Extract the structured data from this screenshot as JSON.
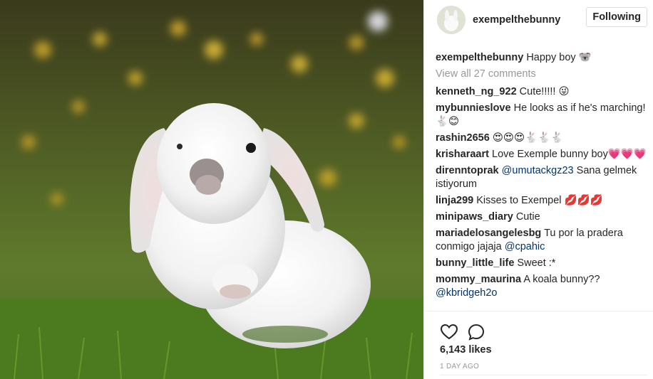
{
  "post": {
    "username": "exempelthebunny",
    "follow_label": "Following",
    "caption_user": "exempelthebunny",
    "caption_text": "Happy boy 🐨",
    "view_all": "View all 27 comments",
    "comments": [
      {
        "user": "kenneth_ng_922",
        "text": "Cute!!!!! 😜",
        "mention": ""
      },
      {
        "user": "mybunnieslove",
        "text": "He looks as if he's marching! 🐇😊",
        "mention": ""
      },
      {
        "user": "rashin2656",
        "text": "😍😍😍🐇🐇🐇",
        "mention": ""
      },
      {
        "user": "krisharaart",
        "text": "Love Exemple bunny boy💗💗💗",
        "mention": ""
      },
      {
        "user": "direnntoprak",
        "text": "",
        "mention": "@umutackgz23",
        "after": "Sana gelmek istiyorum"
      },
      {
        "user": "linja299",
        "text": "Kisses to Exempel 💋💋💋",
        "mention": ""
      },
      {
        "user": "minipaws_diary",
        "text": "Cutie",
        "mention": ""
      },
      {
        "user": "mariadelosangelesbg",
        "text": "Tu por la pradera conmigo jajaja",
        "mention": "@cpahic"
      },
      {
        "user": "bunny_little_life",
        "text": "Sweet :*",
        "mention": ""
      },
      {
        "user": "mommy_maurina",
        "text": "A koala bunny??",
        "mention": "@kbridgeh2o"
      }
    ],
    "likes": "6,143 likes",
    "timestamp": "1 DAY AGO",
    "icons": {
      "like": "heart-outline-icon",
      "comment": "comment-bubble-icon"
    }
  },
  "colors": {
    "link": "#003569",
    "muted": "#999999",
    "text": "#262626"
  }
}
